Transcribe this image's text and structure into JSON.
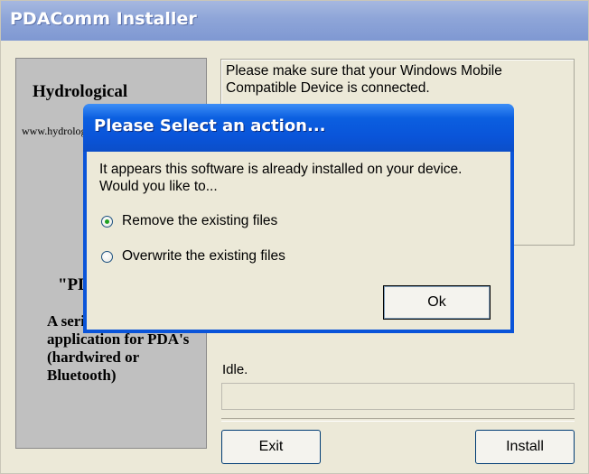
{
  "window": {
    "title": "PDAComm Installer"
  },
  "left_panel": {
    "org": "Hydrological",
    "url": "www.hydrologicals.com",
    "app_name": "\"PDAComm\"",
    "description": "A serial comms application for PDA's (hardwired or Bluetooth)"
  },
  "message": "Please make sure that your Windows Mobile Compatible Device is connected.",
  "status": "Idle.",
  "progress": 0,
  "buttons": {
    "exit": "Exit",
    "install": "Install"
  },
  "dialog": {
    "title": "Please Select an action...",
    "message": "It appears this software is already installed on your device. Would you like to...",
    "options": [
      {
        "label": "Remove the existing files",
        "selected": true
      },
      {
        "label": "Overwrite the existing files",
        "selected": false
      }
    ],
    "ok_label": "Ok"
  },
  "colors": {
    "dialog_title_blue": "#0a54d9",
    "window_title_blue": "#8ea5d8",
    "face": "#ece9d8",
    "panel_gray": "#c0c0c0"
  }
}
